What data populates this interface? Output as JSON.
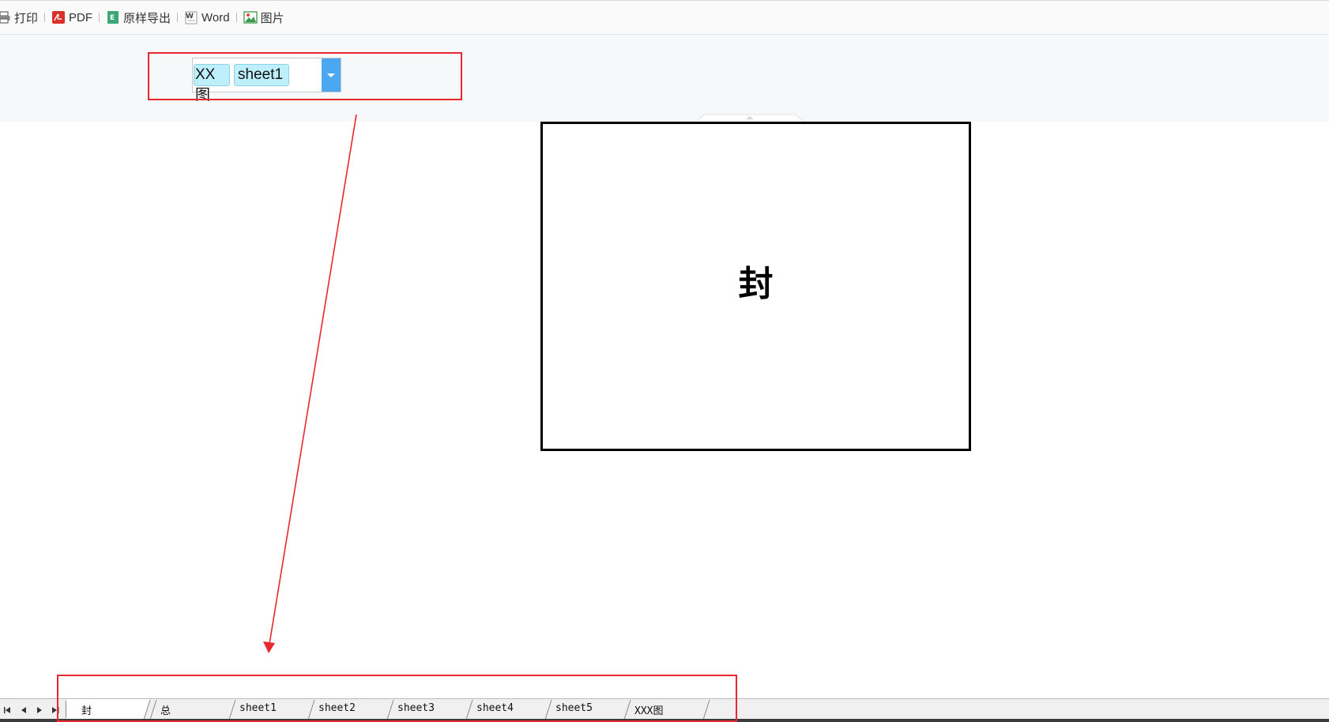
{
  "toolbar": {
    "items": [
      {
        "label": "打印",
        "icon": "printer-icon"
      },
      {
        "label": "PDF",
        "icon": "pdf-icon"
      },
      {
        "label": "原样导出",
        "icon": "excel-icon"
      },
      {
        "label": "Word",
        "icon": "word-icon"
      },
      {
        "label": "图片",
        "icon": "image-icon"
      }
    ]
  },
  "sheet_selector": {
    "selected": [
      "XX图",
      "sheet1"
    ]
  },
  "page": {
    "cell_text": "封"
  },
  "sheet_tabs": {
    "nav_icons": [
      "first-sheet-icon",
      "prev-sheet-icon",
      "next-sheet-icon",
      "last-sheet-icon"
    ],
    "tabs": [
      "封",
      "总",
      "sheet1",
      "sheet2",
      "sheet3",
      "sheet4",
      "sheet5",
      "XXX图"
    ],
    "active": "封"
  },
  "colors": {
    "annotation": "#e8282e",
    "accent": "#4ba7f0",
    "chip": "#bdeffd"
  }
}
